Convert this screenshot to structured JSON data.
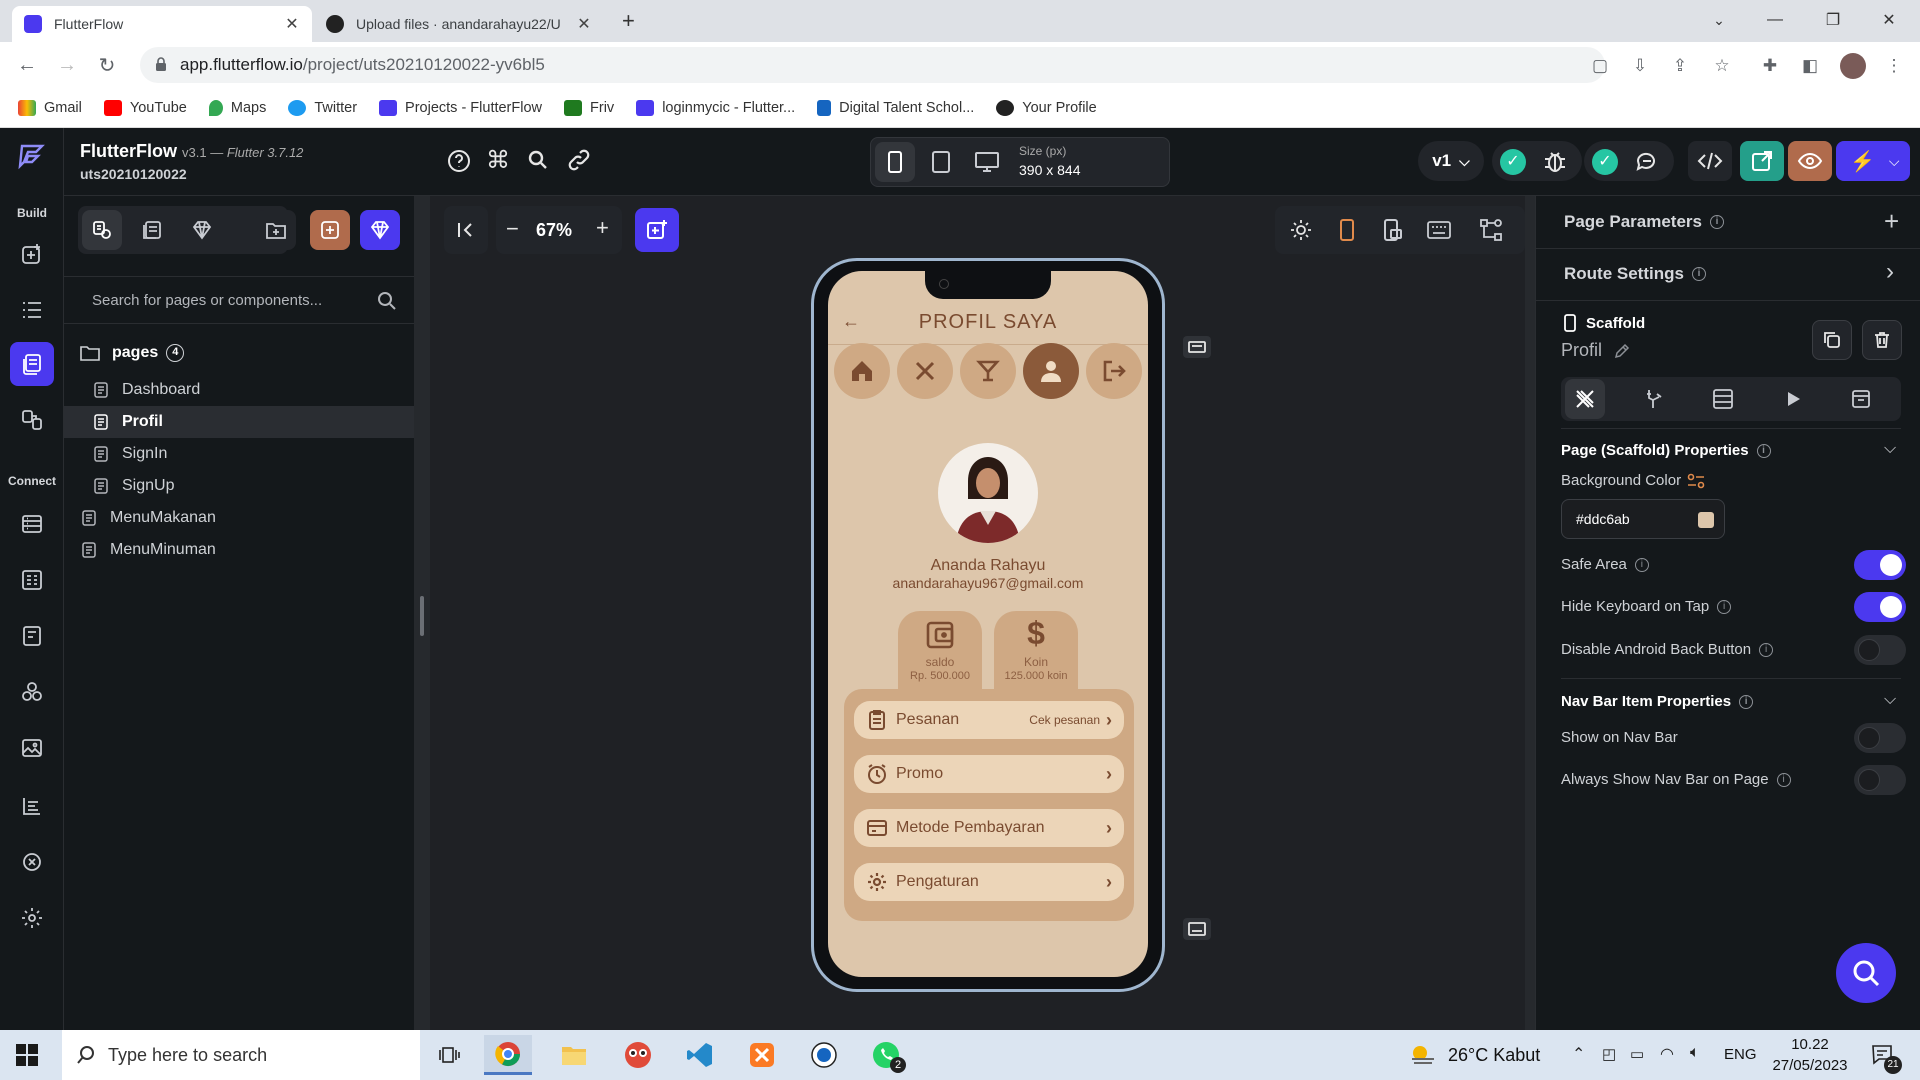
{
  "browser": {
    "tabs": [
      {
        "title": "FlutterFlow",
        "active": true
      },
      {
        "title": "Upload files · anandarahayu22/U",
        "active": false
      }
    ],
    "url_host": "app.flutterflow.io",
    "url_path": "/project/uts20210120022-yv6bl5",
    "bookmarks": [
      "Gmail",
      "YouTube",
      "Maps",
      "Twitter",
      "Projects - FlutterFlow",
      "Friv",
      "loginmycic - Flutter...",
      "Digital Talent Schol...",
      "Your Profile"
    ]
  },
  "app": {
    "name": "FlutterFlow",
    "version": "v3.1 — ",
    "flutter": "Flutter 3.7.12",
    "project": "uts20210120022",
    "rail_build": "Build",
    "rail_connect": "Connect",
    "device_size_label": "Size (px)",
    "device_size": "390 x 844",
    "version_select": "v1",
    "zoom": "67%"
  },
  "left_panel": {
    "search_placeholder": "Search for pages or components...",
    "folder": "pages",
    "folder_count": "4",
    "pages": [
      "Dashboard",
      "Profil",
      "SignIn",
      "SignUp"
    ],
    "components": [
      "MenuMakanan",
      "MenuMinuman"
    ],
    "selected_page": "Profil"
  },
  "phone": {
    "title": "PROFIL SAYA",
    "name": "Ananda Rahayu",
    "email": "anandarahayu967@gmail.com",
    "cards": [
      {
        "label": "saldo",
        "value": "Rp. 500.000"
      },
      {
        "label": "Koin",
        "value": "125.000 koin"
      }
    ],
    "menu": [
      {
        "label": "Pesanan",
        "action": "Cek pesanan"
      },
      {
        "label": "Promo",
        "action": ""
      },
      {
        "label": "Metode Pembayaran",
        "action": ""
      },
      {
        "label": "Pengaturan",
        "action": ""
      }
    ]
  },
  "right_panel": {
    "page_parameters": "Page Parameters",
    "route_settings": "Route Settings",
    "scaffold": "Scaffold",
    "page_name": "Profil",
    "scaffold_props": "Page (Scaffold) Properties",
    "bg_color_label": "Background Color",
    "bg_color_value": "#ddc6ab",
    "safe_area": "Safe Area",
    "hide_keyboard": "Hide Keyboard on Tap",
    "disable_back": "Disable Android Back Button",
    "navbar_props": "Nav Bar Item Properties",
    "show_navbar": "Show on Nav Bar",
    "always_show_navbar": "Always Show Nav Bar on Page",
    "toggles": {
      "safe_area": true,
      "hide_keyboard": true,
      "disable_back": false,
      "show_navbar": false,
      "always_show_navbar": false
    }
  },
  "taskbar": {
    "search_placeholder": "Type here to search",
    "weather": "26°C  Kabut",
    "lang": "ENG",
    "time": "10.22",
    "date": "27/05/2023",
    "whatsapp_badge": "2",
    "notif_badge": "21"
  },
  "colors": {
    "accent": "#4b39ef",
    "scaffold_bg": "#ddc6ab",
    "brown": "#7a4b30",
    "nav_active": "#8b5a3a"
  }
}
